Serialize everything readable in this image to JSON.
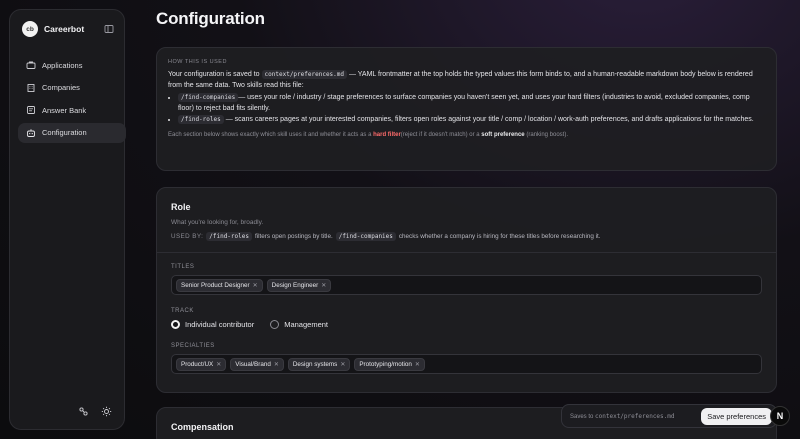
{
  "sidebar": {
    "logo": "cb",
    "app_name": "Careerbot",
    "items": [
      {
        "label": "Applications",
        "icon": "briefcase-icon"
      },
      {
        "label": "Companies",
        "icon": "building-icon"
      },
      {
        "label": "Answer Bank",
        "icon": "book-icon"
      },
      {
        "label": "Configuration",
        "icon": "bot-icon",
        "active": true
      }
    ]
  },
  "page": {
    "title": "Configuration"
  },
  "info": {
    "eyebrow": "HOW THIS IS USED",
    "intro_1": "Your configuration is saved to ",
    "file": "context/preferences.md",
    "intro_2": " — YAML frontmatter at the top holds the typed values this form binds to, and a human-readable markdown body below is rendered from the same data. Two skills read this file:",
    "bullets": [
      {
        "cmd": "/find-companies",
        "text": "— uses your role / industry / stage preferences to surface companies you haven't seen yet, and uses your hard filters (industries to avoid, excluded companies, comp floor) to reject bad fits silently."
      },
      {
        "cmd": "/find-roles",
        "text": " — scans careers pages at your interested companies, filters open roles against your title / comp / location / work-auth preferences, and drafts applications for the matches."
      }
    ],
    "note_1": "Each section below shows exactly which skill uses it and whether it acts as a ",
    "note_hard": "hard filter",
    "note_2": "(reject if it doesn't match) or a ",
    "note_soft": "soft preference",
    "note_3": " (ranking boost)."
  },
  "role": {
    "title": "Role",
    "subtitle": "What you're looking for, broadly.",
    "used_by_label": "USED BY:",
    "cmd_1": "/find-roles",
    "text_1": "filters open postings by title.",
    "cmd_2": "/find-companies",
    "text_2": "checks whether a company is hiring for these titles before researching it.",
    "titles_label": "TITLES",
    "titles": [
      "Senior Product Designer",
      "Design Engineer"
    ],
    "track_label": "TRACK",
    "track_options": [
      "Individual contributor",
      "Management"
    ],
    "track_selected": "Individual contributor",
    "specialties_label": "SPECIALTIES",
    "specialties": [
      "Product/UX",
      "Visual/Brand",
      "Design systems",
      "Prototyping/motion"
    ]
  },
  "compensation": {
    "title": "Compensation"
  },
  "savebar": {
    "note_prefix": "Saves to ",
    "file": "context/preferences.md",
    "button": "Save preferences"
  },
  "badge": "N",
  "colors": {
    "accent_hard": "#ff6b6b",
    "background": "#0c0c0e"
  }
}
